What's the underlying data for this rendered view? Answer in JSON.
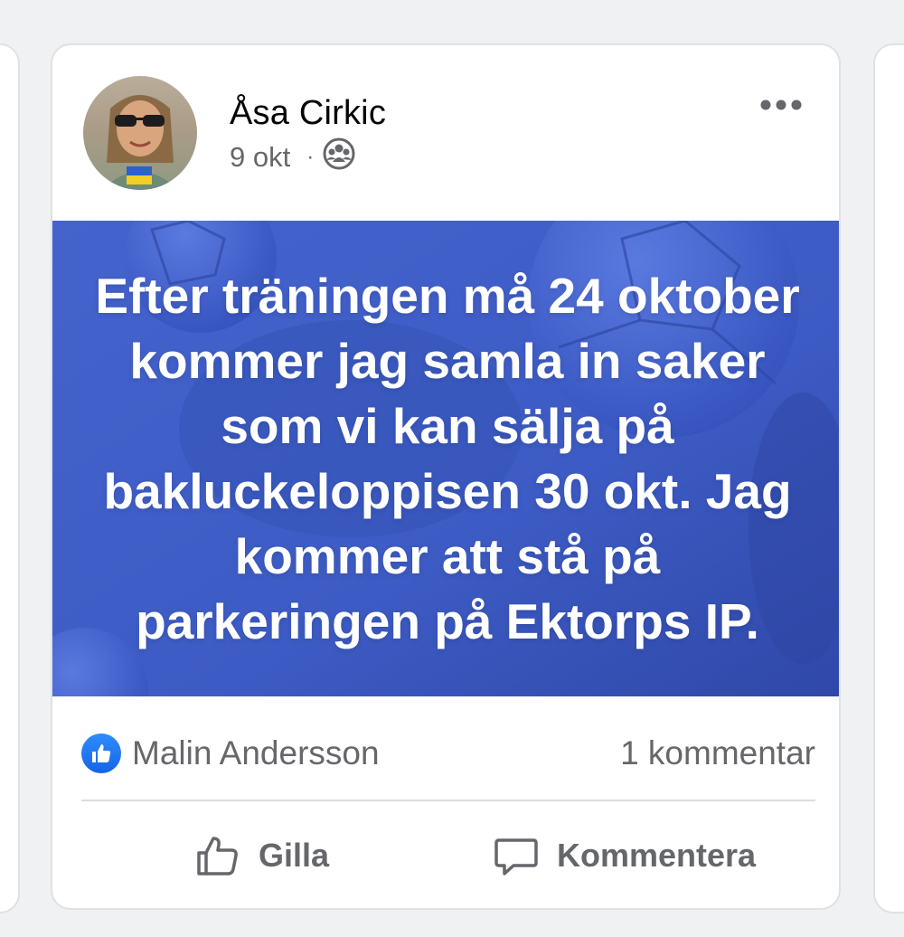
{
  "post": {
    "author": "Åsa Cirkic",
    "date": "9 okt",
    "separator": "·",
    "audience_icon": "group-icon",
    "menu_icon": "more-options-icon",
    "banner_text": "Efter träningen må 24 oktober kommer jag samla in saker som vi kan sälja på bakluckeloppisen 30 okt. Jag kommer att stå på parkeringen på Ektorps IP.",
    "banner_color": "#3d5bc4"
  },
  "reactions": {
    "icon": "like-reaction-icon",
    "name": "Malin Andersson",
    "comment_count": "1 kommentar"
  },
  "actions": {
    "like_label": "Gilla",
    "comment_label": "Kommentera"
  },
  "colors": {
    "secondary_text": "#65676b",
    "like_blue": "#1877f2"
  }
}
